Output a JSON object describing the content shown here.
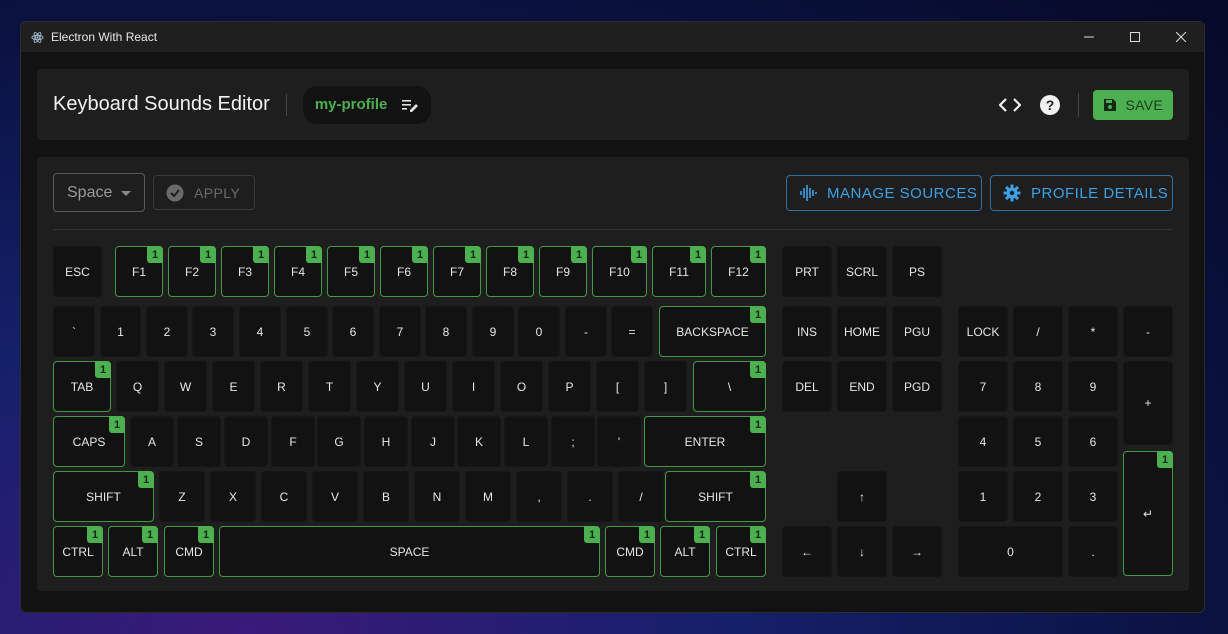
{
  "window": {
    "title": "Electron With React"
  },
  "header": {
    "title": "Keyboard Sounds Editor",
    "profile_name": "my-profile",
    "save_label": "SAVE"
  },
  "toolbar": {
    "key_select_value": "Space",
    "apply_label": "APPLY",
    "manage_sources_label": "MANAGE SOURCES",
    "profile_details_label": "PROFILE DETAILS"
  },
  "colors": {
    "accent_green": "#4caf50",
    "accent_blue": "#3ea0e6"
  },
  "keyboard": {
    "keys": [
      {
        "id": "esc",
        "label": "ESC",
        "badge": ""
      },
      {
        "id": "f1",
        "label": "F1",
        "badge": "1"
      },
      {
        "id": "f2",
        "label": "F2",
        "badge": "1"
      },
      {
        "id": "f3",
        "label": "F3",
        "badge": "1"
      },
      {
        "id": "f4",
        "label": "F4",
        "badge": "1"
      },
      {
        "id": "f5",
        "label": "F5",
        "badge": "1"
      },
      {
        "id": "f6",
        "label": "F6",
        "badge": "1"
      },
      {
        "id": "f7",
        "label": "F7",
        "badge": "1"
      },
      {
        "id": "f8",
        "label": "F8",
        "badge": "1"
      },
      {
        "id": "f9",
        "label": "F9",
        "badge": "1"
      },
      {
        "id": "f10",
        "label": "F10",
        "badge": "1"
      },
      {
        "id": "f11",
        "label": "F11",
        "badge": "1"
      },
      {
        "id": "f12",
        "label": "F12",
        "badge": "1"
      },
      {
        "id": "prt",
        "label": "PRT",
        "badge": ""
      },
      {
        "id": "scrl",
        "label": "SCRL",
        "badge": ""
      },
      {
        "id": "ps",
        "label": "PS",
        "badge": ""
      },
      {
        "id": "backtick",
        "label": "`",
        "badge": ""
      },
      {
        "id": "1",
        "label": "1",
        "badge": ""
      },
      {
        "id": "2",
        "label": "2",
        "badge": ""
      },
      {
        "id": "3",
        "label": "3",
        "badge": ""
      },
      {
        "id": "4",
        "label": "4",
        "badge": ""
      },
      {
        "id": "5",
        "label": "5",
        "badge": ""
      },
      {
        "id": "6",
        "label": "6",
        "badge": ""
      },
      {
        "id": "7",
        "label": "7",
        "badge": ""
      },
      {
        "id": "8",
        "label": "8",
        "badge": ""
      },
      {
        "id": "9",
        "label": "9",
        "badge": ""
      },
      {
        "id": "0",
        "label": "0",
        "badge": ""
      },
      {
        "id": "minus",
        "label": "-",
        "badge": ""
      },
      {
        "id": "equals",
        "label": "=",
        "badge": ""
      },
      {
        "id": "backspace",
        "label": "BACKSPACE",
        "badge": "1"
      },
      {
        "id": "ins",
        "label": "INS",
        "badge": ""
      },
      {
        "id": "home",
        "label": "HOME",
        "badge": ""
      },
      {
        "id": "pgu",
        "label": "PGU",
        "badge": ""
      },
      {
        "id": "numlock",
        "label": "LOCK",
        "badge": ""
      },
      {
        "id": "numdiv",
        "label": "/",
        "badge": ""
      },
      {
        "id": "nummul",
        "label": "*",
        "badge": ""
      },
      {
        "id": "numsub",
        "label": "-",
        "badge": ""
      },
      {
        "id": "tab",
        "label": "TAB",
        "badge": "1"
      },
      {
        "id": "q",
        "label": "Q",
        "badge": ""
      },
      {
        "id": "w",
        "label": "W",
        "badge": ""
      },
      {
        "id": "e",
        "label": "E",
        "badge": ""
      },
      {
        "id": "r",
        "label": "R",
        "badge": ""
      },
      {
        "id": "t",
        "label": "T",
        "badge": ""
      },
      {
        "id": "y",
        "label": "Y",
        "badge": ""
      },
      {
        "id": "u",
        "label": "U",
        "badge": ""
      },
      {
        "id": "i",
        "label": "I",
        "badge": ""
      },
      {
        "id": "o",
        "label": "O",
        "badge": ""
      },
      {
        "id": "p",
        "label": "P",
        "badge": ""
      },
      {
        "id": "lbracket",
        "label": "[",
        "badge": ""
      },
      {
        "id": "rbracket",
        "label": "]",
        "badge": ""
      },
      {
        "id": "backslash",
        "label": "\\",
        "badge": "1"
      },
      {
        "id": "del",
        "label": "DEL",
        "badge": ""
      },
      {
        "id": "end",
        "label": "END",
        "badge": ""
      },
      {
        "id": "pgd",
        "label": "PGD",
        "badge": ""
      },
      {
        "id": "num7",
        "label": "7",
        "badge": ""
      },
      {
        "id": "num8",
        "label": "8",
        "badge": ""
      },
      {
        "id": "num9",
        "label": "9",
        "badge": ""
      },
      {
        "id": "numadd",
        "label": "+",
        "badge": ""
      },
      {
        "id": "caps",
        "label": "CAPS",
        "badge": "1"
      },
      {
        "id": "a",
        "label": "A",
        "badge": ""
      },
      {
        "id": "s",
        "label": "S",
        "badge": ""
      },
      {
        "id": "d",
        "label": "D",
        "badge": ""
      },
      {
        "id": "f",
        "label": "F",
        "badge": ""
      },
      {
        "id": "g",
        "label": "G",
        "badge": ""
      },
      {
        "id": "h",
        "label": "H",
        "badge": ""
      },
      {
        "id": "j",
        "label": "J",
        "badge": ""
      },
      {
        "id": "k",
        "label": "K",
        "badge": ""
      },
      {
        "id": "l",
        "label": "L",
        "badge": ""
      },
      {
        "id": "semicolon",
        "label": ";",
        "badge": ""
      },
      {
        "id": "quote",
        "label": "'",
        "badge": ""
      },
      {
        "id": "enter",
        "label": "ENTER",
        "badge": "1"
      },
      {
        "id": "num4",
        "label": "4",
        "badge": ""
      },
      {
        "id": "num5",
        "label": "5",
        "badge": ""
      },
      {
        "id": "num6",
        "label": "6",
        "badge": ""
      },
      {
        "id": "lshift",
        "label": "SHIFT",
        "badge": "1"
      },
      {
        "id": "z",
        "label": "Z",
        "badge": ""
      },
      {
        "id": "x",
        "label": "X",
        "badge": ""
      },
      {
        "id": "c",
        "label": "C",
        "badge": ""
      },
      {
        "id": "v",
        "label": "V",
        "badge": ""
      },
      {
        "id": "b",
        "label": "B",
        "badge": ""
      },
      {
        "id": "n",
        "label": "N",
        "badge": ""
      },
      {
        "id": "m",
        "label": "M",
        "badge": ""
      },
      {
        "id": "comma",
        "label": ",",
        "badge": ""
      },
      {
        "id": "period",
        "label": ".",
        "badge": ""
      },
      {
        "id": "slash",
        "label": "/",
        "badge": ""
      },
      {
        "id": "rshift",
        "label": "SHIFT",
        "badge": "1"
      },
      {
        "id": "up",
        "label": "↑",
        "badge": ""
      },
      {
        "id": "num1",
        "label": "1",
        "badge": ""
      },
      {
        "id": "num2",
        "label": "2",
        "badge": ""
      },
      {
        "id": "num3",
        "label": "3",
        "badge": ""
      },
      {
        "id": "numenter",
        "label": "↵",
        "badge": "1"
      },
      {
        "id": "lctrl",
        "label": "CTRL",
        "badge": "1"
      },
      {
        "id": "lalt",
        "label": "ALT",
        "badge": "1"
      },
      {
        "id": "lcmd",
        "label": "CMD",
        "badge": "1"
      },
      {
        "id": "space",
        "label": "SPACE",
        "badge": "1"
      },
      {
        "id": "rcmd",
        "label": "CMD",
        "badge": "1"
      },
      {
        "id": "ralt",
        "label": "ALT",
        "badge": "1"
      },
      {
        "id": "rctrl",
        "label": "CTRL",
        "badge": "1"
      },
      {
        "id": "left",
        "label": "←",
        "badge": ""
      },
      {
        "id": "down",
        "label": "↓",
        "badge": ""
      },
      {
        "id": "right",
        "label": "→",
        "badge": ""
      },
      {
        "id": "num0",
        "label": "0",
        "badge": ""
      },
      {
        "id": "numdot",
        "label": ".",
        "badge": ""
      }
    ]
  }
}
